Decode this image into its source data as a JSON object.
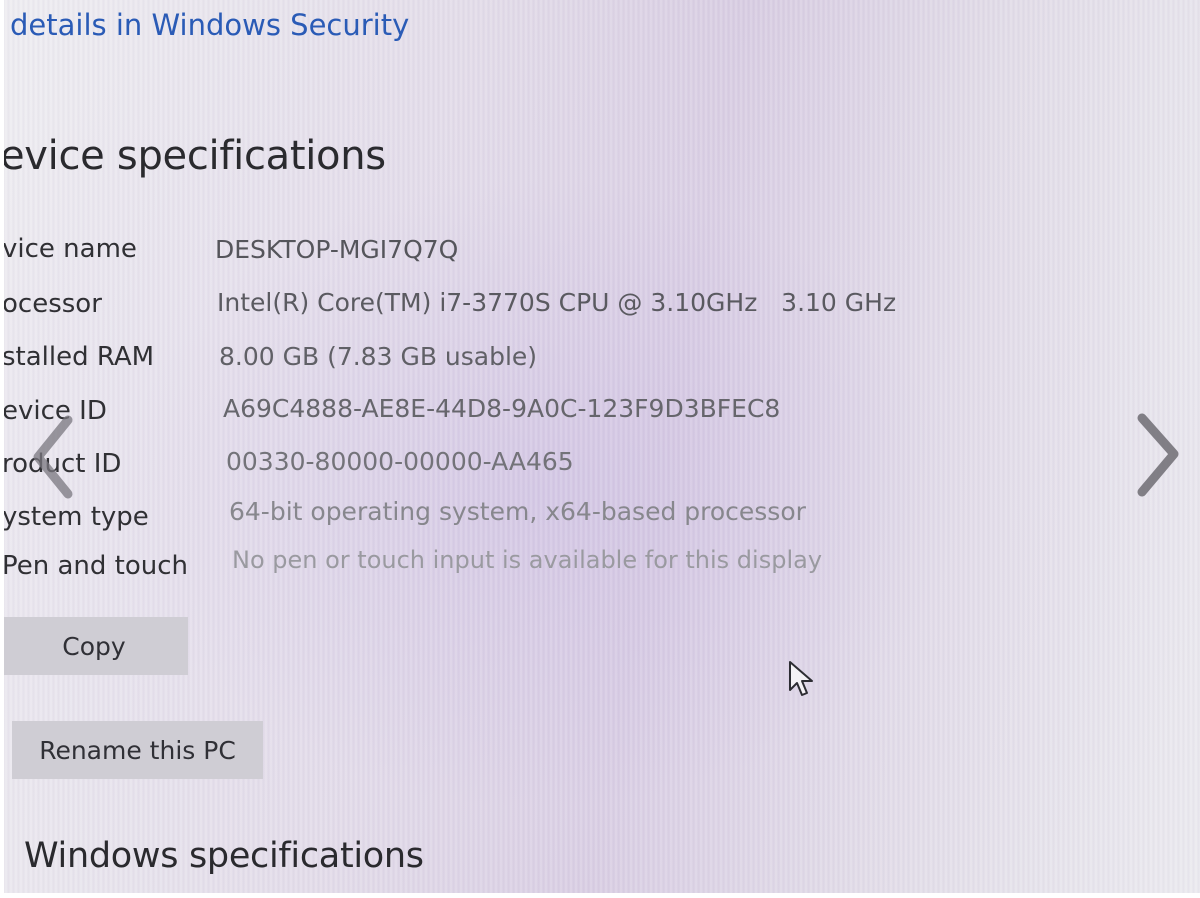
{
  "header": {
    "security_link": "details in Windows Security"
  },
  "device_specs": {
    "title": "evice specifications",
    "rows": [
      {
        "label": "vice name",
        "value": "DESKTOP-MGI7Q7Q"
      },
      {
        "label": "ocessor",
        "value": "Intel(R) Core(TM) i7-3770S CPU @ 3.10GHz   3.10 GHz"
      },
      {
        "label": "stalled RAM",
        "value": "8.00 GB (7.83 GB usable)"
      },
      {
        "label": "evice ID",
        "value": "A69C4888-AE8E-44D8-9A0C-123F9D3BFEC8"
      },
      {
        "label": "roduct ID",
        "value": "00330-80000-00000-AA465"
      },
      {
        "label": "ystem type",
        "value": "64-bit operating system, x64-based processor"
      },
      {
        "label": "Pen and touch",
        "value": "No pen or touch input is available for this display"
      }
    ],
    "copy_label": "Copy",
    "rename_label": "Rename this PC"
  },
  "windows_specs": {
    "title": "Windows specifications"
  },
  "icons": {
    "prev": "chevron-left-icon",
    "next": "chevron-right-icon",
    "pointer": "mouse-pointer-icon"
  },
  "colors": {
    "link": "#2a5bb6",
    "label": "#303034",
    "button": "#cfcdd4"
  }
}
